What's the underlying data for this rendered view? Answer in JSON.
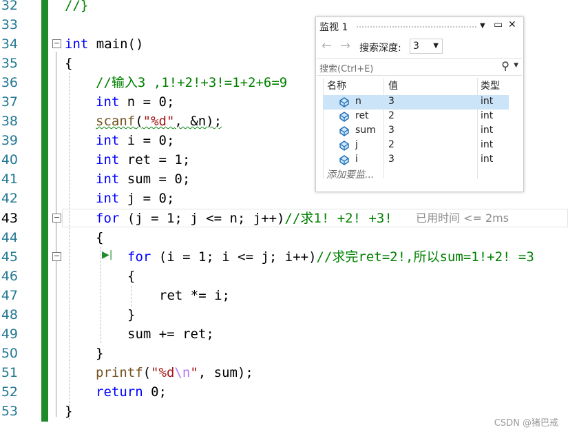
{
  "editor": {
    "line_numbers": [
      "32",
      "33",
      "34",
      "35",
      "36",
      "37",
      "38",
      "39",
      "40",
      "41",
      "42",
      "43",
      "44",
      "45",
      "46",
      "47",
      "48",
      "49",
      "50",
      "51",
      "52",
      "53"
    ],
    "current_line": "43",
    "code": {
      "l32": "//}",
      "l34_kw": "int",
      "l34_rest": " main()",
      "l35": "{",
      "l36": "//输入3 ,1!+2!+3!=1+2+6=9",
      "l37_kw": "int",
      "l37_rest": " n = 0;",
      "l38_fn": "scanf",
      "l38_open": "(",
      "l38_str": "\"%d\"",
      "l38_rest": ", &n);",
      "l39_kw": "int",
      "l39_rest": " i = 0;",
      "l40_kw": "int",
      "l40_rest": " ret = 1;",
      "l41_kw": "int",
      "l41_rest": " sum = 0;",
      "l42_kw": "int",
      "l42_rest": " j = 0;",
      "l43_kw": "for",
      "l43_rest": " (j = 1; j <= n; j++)",
      "l43_cm": "//求1! +2! +3!",
      "l44": "{",
      "l45_kw": "for",
      "l45_rest": " (i = 1; i <= j; i++)",
      "l45_cm": "//求完ret=2!,所以sum=1!+2! =3",
      "l46": "{",
      "l47": "ret *= i;",
      "l48": "}",
      "l49": "sum += ret;",
      "l50": "}",
      "l51_fn": "printf",
      "l51_open": "(",
      "l51_str1": "\"%d",
      "l51_esc": "\\n",
      "l51_str2": "\"",
      "l51_rest": ", sum);",
      "l52_kw": "return",
      "l52_rest": " 0;",
      "l53": "}"
    },
    "elapsed_hint": "已用时间 <= 2ms"
  },
  "watch": {
    "title": "监视 1",
    "search_depth_label": "搜索深度:",
    "search_depth_value": "3",
    "search_placeholder": "搜索(Ctrl+E)",
    "columns": {
      "name": "名称",
      "value": "值",
      "type": "类型"
    },
    "rows": [
      {
        "name": "n",
        "value": "3",
        "type": "int"
      },
      {
        "name": "ret",
        "value": "2",
        "type": "int"
      },
      {
        "name": "sum",
        "value": "3",
        "type": "int"
      },
      {
        "name": "j",
        "value": "2",
        "type": "int"
      },
      {
        "name": "i",
        "value": "3",
        "type": "int"
      }
    ],
    "add_item": "添加要监...",
    "icons": {
      "pin": "dropdown-caret-icon",
      "maximize": "maximize-icon",
      "close": "close-icon"
    }
  },
  "watermark": "CSDN @猪巴戒",
  "colors": {
    "gutter": "#1f8a2a",
    "keyword": "#0000ff",
    "comment": "#008000",
    "string": "#a31515"
  }
}
